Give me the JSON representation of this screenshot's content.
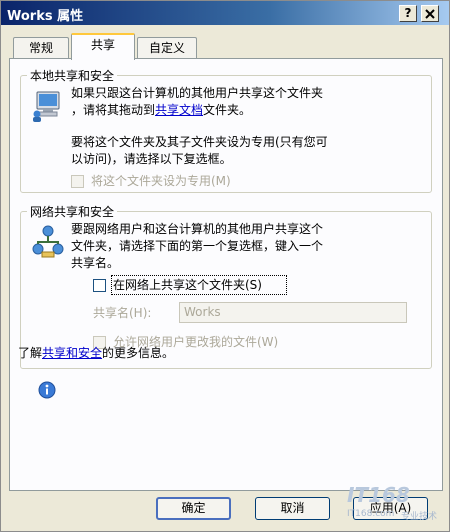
{
  "window": {
    "title": "Works 属性",
    "help_btn": "?",
    "close_btn": "✕"
  },
  "tabs": [
    {
      "label": "常规",
      "active": false
    },
    {
      "label": "共享",
      "active": true
    },
    {
      "label": "自定义",
      "active": false
    }
  ],
  "local_group": {
    "title": "本地共享和安全",
    "text_line1": "如果只跟这台计算机的其他用户共享这个文件夹",
    "text_line2_pre": "，请将其拖动到",
    "text_line2_link": "共享文档",
    "text_line2_post": "文件夹。",
    "text_line3": "要将这个文件夹及其子文件夹设为专用(只有您可",
    "text_line4": "以访问)，请选择以下复选框。",
    "private_checkbox_label": "将这个文件夹设为专用(M)",
    "private_checked": false,
    "private_enabled": false
  },
  "network_group": {
    "title": "网络共享和安全",
    "text_line1": "要跟网络用户和这台计算机的其他用户共享这个",
    "text_line2": "文件夹，请选择下面的第一个复选框，键入一个",
    "text_line3": "共享名。",
    "share_checkbox_label": "在网络上共享这个文件夹(S)",
    "share_checked": false,
    "share_name_label": "共享名(H):",
    "share_name_value": "Works",
    "allow_change_label": "允许网络用户更改我的文件(W)",
    "allow_change_checked": false,
    "allow_change_enabled": false
  },
  "learn_more": {
    "pre": "了解",
    "link": "共享和安全",
    "post": "的更多信息。"
  },
  "buttons": {
    "ok": "确定",
    "cancel": "取消",
    "apply": "应用(A)"
  },
  "watermark": {
    "brand": "IT168",
    "site": "IT168.com",
    "slogan": "专业技术",
    "logo_text": "IT168.com 创新 传播 分享"
  }
}
